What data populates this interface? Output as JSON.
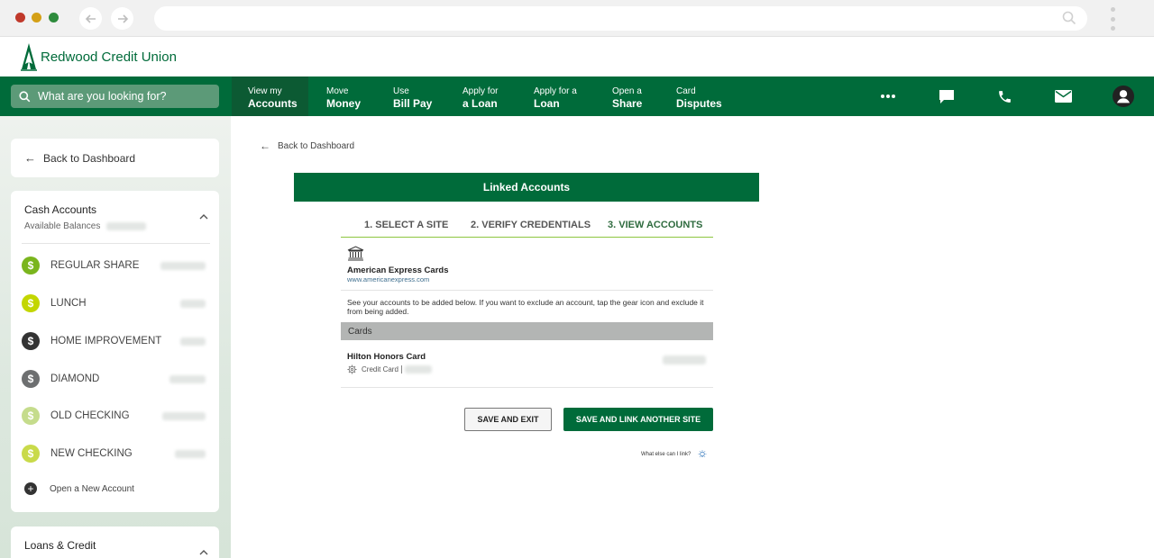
{
  "browser": {
    "dots": [
      "#c0392b",
      "#d4a017",
      "#2e8b3d"
    ],
    "back_icon": "arrow-left-icon",
    "forward_icon": "arrow-right-icon",
    "url": ""
  },
  "brand": {
    "name": "Redwood Credit Union",
    "color": "#006b3a"
  },
  "nav": {
    "search_placeholder": "What are you looking for?",
    "items": [
      {
        "top": "View my",
        "bottom": "Accounts",
        "active": true
      },
      {
        "top": "Move",
        "bottom": "Money"
      },
      {
        "top": "Use",
        "bottom": "Bill Pay"
      },
      {
        "top": "Apply for",
        "bottom": "a Loan"
      },
      {
        "top": "Apply for a",
        "bottom": "Loan"
      },
      {
        "top": "Open a",
        "bottom": "Share"
      },
      {
        "top": "Card",
        "bottom": "Disputes"
      }
    ],
    "icons": [
      "more-icon",
      "chat-icon",
      "phone-icon",
      "mail-icon",
      "profile-icon"
    ]
  },
  "sidebar": {
    "back_label": "Back to Dashboard",
    "cash": {
      "title": "Cash Accounts",
      "subtitle": "Available Balances",
      "accounts": [
        {
          "name": "REGULAR SHARE",
          "color": "#7ab51d"
        },
        {
          "name": "LUNCH",
          "color": "#c3d600"
        },
        {
          "name": "HOME IMPROVEMENT",
          "color": "#333333"
        },
        {
          "name": "DIAMOND",
          "color": "#6d6f70"
        },
        {
          "name": "OLD CHECKING",
          "color": "#c5dc8c"
        },
        {
          "name": "NEW CHECKING",
          "color": "#c9da4a"
        }
      ],
      "open_label": "Open a New Account"
    },
    "loans": {
      "title": "Loans & Credit"
    }
  },
  "content": {
    "back_label": "Back to Dashboard",
    "panel_title": "Linked Accounts",
    "steps": [
      "1. SELECT A SITE",
      "2. VERIFY CREDENTIALS",
      "3. VIEW ACCOUNTS"
    ],
    "current_step": 3,
    "site": {
      "name": "American Express Cards",
      "url": "www.americanexpress.com"
    },
    "info": "See your accounts to be added below. If you want to exclude an account, tap the gear icon and exclude it from being added.",
    "section_label": "Cards",
    "card": {
      "name": "Hilton Honors Card",
      "type": "Credit Card"
    },
    "buttons": {
      "exit": "SAVE AND EXIT",
      "link_another": "SAVE AND LINK ANOTHER SITE"
    },
    "help_text": "What else can I link?"
  }
}
